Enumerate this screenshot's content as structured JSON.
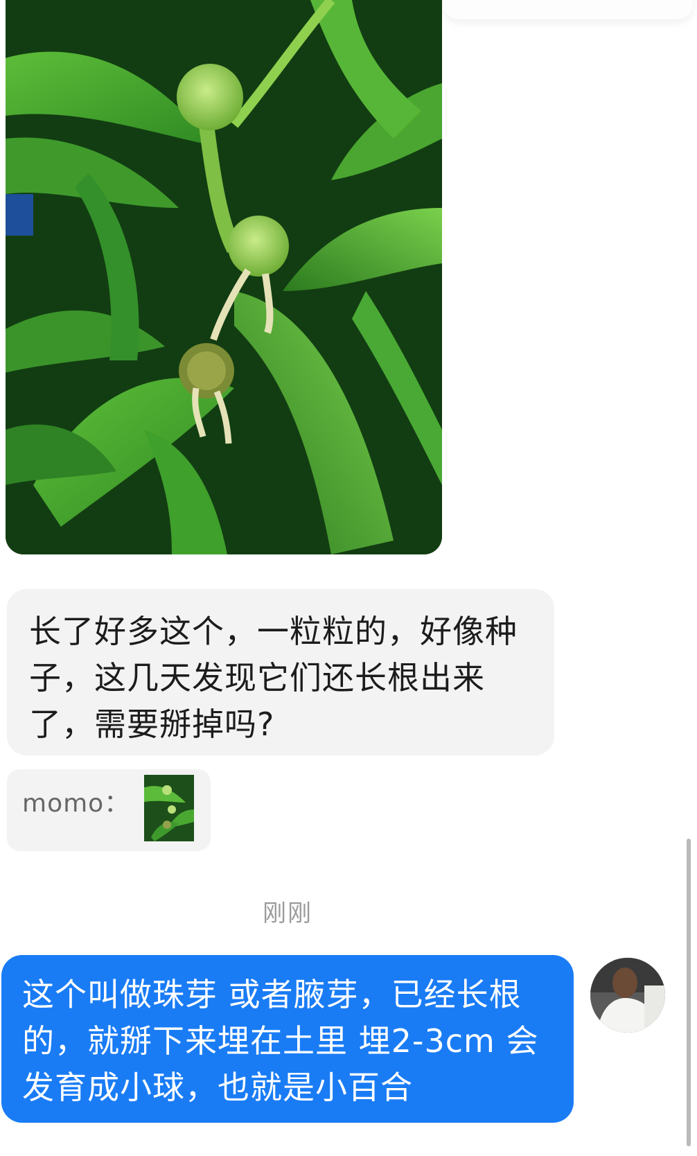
{
  "messages": {
    "photo": {
      "icon": "plant-photo"
    },
    "received_text": "长了好多这个，一粒粒的，好像种子，这几天发现它们还长根出来了，需要掰掉吗?",
    "quote": {
      "name": "momo：",
      "thumb_icon": "plant-photo-thumbnail"
    },
    "timestamp": "刚刚",
    "sent_text": "这个叫做珠芽 或者腋芽，已经长根的，就掰下来埋在土里 埋2-3cm 会发育成小球，也就是小百合",
    "avatar_icon": "user-avatar"
  },
  "colors": {
    "sent_bubble": "#1a7cf5",
    "received_bubble": "#f3f3f3",
    "timestamp_text": "#9b9b9b"
  }
}
